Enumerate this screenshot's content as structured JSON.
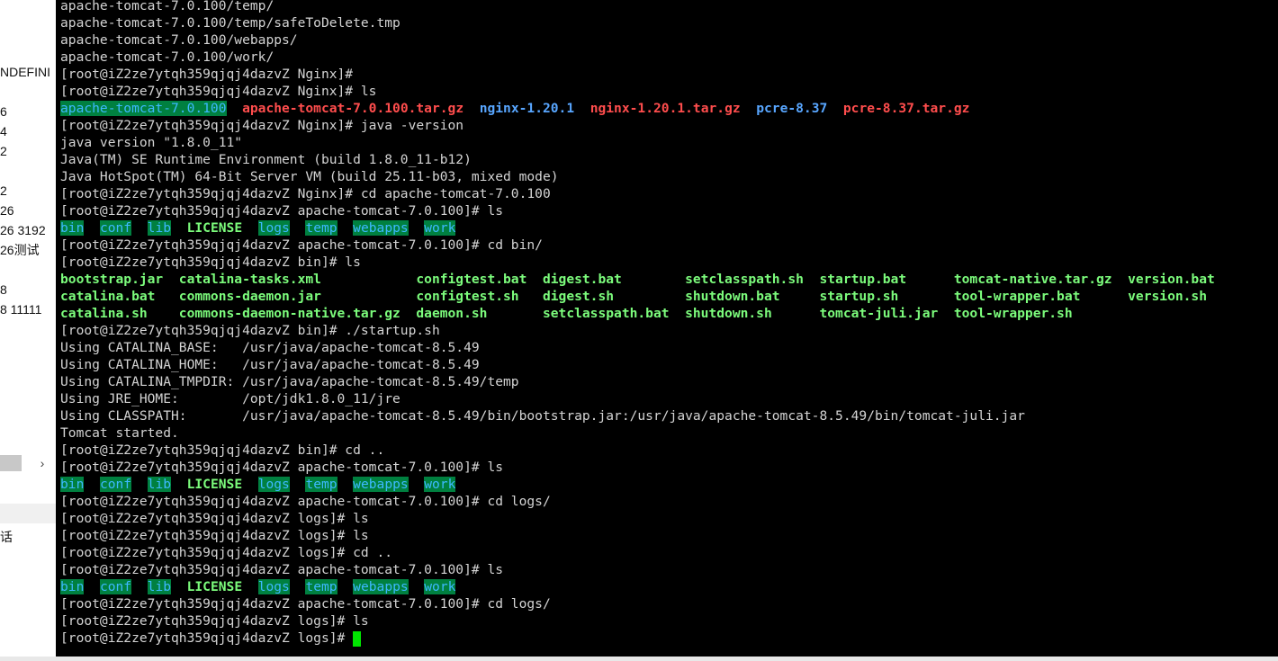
{
  "colors": {
    "background": "#000000",
    "default": "#d4d4d4",
    "dir": "#58a6ff",
    "archive": "#ff4d4d",
    "exec": "#7cfc7c",
    "dir_hl_bg": "#008040",
    "dir_hl_fg": "#3db8ff",
    "cursor": "#00e600"
  },
  "left_panel": {
    "fragments": [
      "NDEFINI",
      "6",
      "4",
      "2",
      "2",
      "26",
      "26  3192",
      "26测试",
      "8",
      "8  11111",
      "话"
    ],
    "scroll_arrow": "›"
  },
  "terminal": {
    "lines": [
      [
        {
          "t": "apache-tomcat-7.0.100/temp/",
          "c": "default"
        }
      ],
      [
        {
          "t": "apache-tomcat-7.0.100/temp/safeToDelete.tmp",
          "c": "default"
        }
      ],
      [
        {
          "t": "apache-tomcat-7.0.100/webapps/",
          "c": "default"
        }
      ],
      [
        {
          "t": "apache-tomcat-7.0.100/work/",
          "c": "default"
        }
      ],
      [
        {
          "t": "[root@iZ2ze7ytqh359qjqj4dazvZ Nginx]#",
          "c": "default"
        }
      ],
      [
        {
          "t": "[root@iZ2ze7ytqh359qjqj4dazvZ Nginx]# ls",
          "c": "default"
        }
      ],
      [
        {
          "t": "apache-tomcat-7.0.100",
          "c": "dirhl"
        },
        {
          "t": "  ",
          "c": "default"
        },
        {
          "t": "apache-tomcat-7.0.100.tar.gz",
          "c": "archive"
        },
        {
          "t": "  ",
          "c": "default"
        },
        {
          "t": "nginx-1.20.1",
          "c": "dir"
        },
        {
          "t": "  ",
          "c": "default"
        },
        {
          "t": "nginx-1.20.1.tar.gz",
          "c": "archive"
        },
        {
          "t": "  ",
          "c": "default"
        },
        {
          "t": "pcre-8.37",
          "c": "dir"
        },
        {
          "t": "  ",
          "c": "default"
        },
        {
          "t": "pcre-8.37.tar.gz",
          "c": "archive"
        }
      ],
      [
        {
          "t": "[root@iZ2ze7ytqh359qjqj4dazvZ Nginx]# java -version",
          "c": "default"
        }
      ],
      [
        {
          "t": "java version \"1.8.0_11\"",
          "c": "default"
        }
      ],
      [
        {
          "t": "Java(TM) SE Runtime Environment (build 1.8.0_11-b12)",
          "c": "default"
        }
      ],
      [
        {
          "t": "Java HotSpot(TM) 64-Bit Server VM (build 25.11-b03, mixed mode)",
          "c": "default"
        }
      ],
      [
        {
          "t": "[root@iZ2ze7ytqh359qjqj4dazvZ Nginx]# cd apache-tomcat-7.0.100",
          "c": "default"
        }
      ],
      [
        {
          "t": "[root@iZ2ze7ytqh359qjqj4dazvZ apache-tomcat-7.0.100]# ls",
          "c": "default"
        }
      ],
      [
        {
          "t": "bin",
          "c": "dirhl"
        },
        {
          "t": "  ",
          "c": "default"
        },
        {
          "t": "conf",
          "c": "dirhl"
        },
        {
          "t": "  ",
          "c": "default"
        },
        {
          "t": "lib",
          "c": "dirhl"
        },
        {
          "t": "  ",
          "c": "default"
        },
        {
          "t": "LICENSE",
          "c": "exec"
        },
        {
          "t": "  ",
          "c": "default"
        },
        {
          "t": "logs",
          "c": "dirhl"
        },
        {
          "t": "  ",
          "c": "default"
        },
        {
          "t": "temp",
          "c": "dirhl"
        },
        {
          "t": "  ",
          "c": "default"
        },
        {
          "t": "webapps",
          "c": "dirhl"
        },
        {
          "t": "  ",
          "c": "default"
        },
        {
          "t": "work",
          "c": "dirhl"
        }
      ],
      [
        {
          "t": "[root@iZ2ze7ytqh359qjqj4dazvZ apache-tomcat-7.0.100]# cd bin/",
          "c": "default"
        }
      ],
      [
        {
          "t": "[root@iZ2ze7ytqh359qjqj4dazvZ bin]# ls",
          "c": "default"
        }
      ],
      [
        {
          "t": "bootstrap.jar  catalina-tasks.xml            configtest.bat  digest.bat        setclasspath.sh  startup.bat      tomcat-native.tar.gz  version.bat",
          "c": "exec"
        }
      ],
      [
        {
          "t": "catalina.bat   commons-daemon.jar            configtest.sh   digest.sh         shutdown.bat     startup.sh       tool-wrapper.bat      version.sh",
          "c": "exec"
        }
      ],
      [
        {
          "t": "catalina.sh    commons-daemon-native.tar.gz  daemon.sh       setclasspath.bat  shutdown.sh      tomcat-juli.jar  tool-wrapper.sh",
          "c": "exec"
        }
      ],
      [
        {
          "t": "[root@iZ2ze7ytqh359qjqj4dazvZ bin]# ./startup.sh",
          "c": "default"
        }
      ],
      [
        {
          "t": "Using CATALINA_BASE:   /usr/java/apache-tomcat-8.5.49",
          "c": "default"
        }
      ],
      [
        {
          "t": "Using CATALINA_HOME:   /usr/java/apache-tomcat-8.5.49",
          "c": "default"
        }
      ],
      [
        {
          "t": "Using CATALINA_TMPDIR: /usr/java/apache-tomcat-8.5.49/temp",
          "c": "default"
        }
      ],
      [
        {
          "t": "Using JRE_HOME:        /opt/jdk1.8.0_11/jre",
          "c": "default"
        }
      ],
      [
        {
          "t": "Using CLASSPATH:       /usr/java/apache-tomcat-8.5.49/bin/bootstrap.jar:/usr/java/apache-tomcat-8.5.49/bin/tomcat-juli.jar",
          "c": "default"
        }
      ],
      [
        {
          "t": "Tomcat started.",
          "c": "default"
        }
      ],
      [
        {
          "t": "[root@iZ2ze7ytqh359qjqj4dazvZ bin]# cd ..",
          "c": "default"
        }
      ],
      [
        {
          "t": "[root@iZ2ze7ytqh359qjqj4dazvZ apache-tomcat-7.0.100]# ls",
          "c": "default"
        }
      ],
      [
        {
          "t": "bin",
          "c": "dirhl"
        },
        {
          "t": "  ",
          "c": "default"
        },
        {
          "t": "conf",
          "c": "dirhl"
        },
        {
          "t": "  ",
          "c": "default"
        },
        {
          "t": "lib",
          "c": "dirhl"
        },
        {
          "t": "  ",
          "c": "default"
        },
        {
          "t": "LICENSE",
          "c": "exec"
        },
        {
          "t": "  ",
          "c": "default"
        },
        {
          "t": "logs",
          "c": "dirhl"
        },
        {
          "t": "  ",
          "c": "default"
        },
        {
          "t": "temp",
          "c": "dirhl"
        },
        {
          "t": "  ",
          "c": "default"
        },
        {
          "t": "webapps",
          "c": "dirhl"
        },
        {
          "t": "  ",
          "c": "default"
        },
        {
          "t": "work",
          "c": "dirhl"
        }
      ],
      [
        {
          "t": "[root@iZ2ze7ytqh359qjqj4dazvZ apache-tomcat-7.0.100]# cd logs/",
          "c": "default"
        }
      ],
      [
        {
          "t": "[root@iZ2ze7ytqh359qjqj4dazvZ logs]# ls",
          "c": "default"
        }
      ],
      [
        {
          "t": "[root@iZ2ze7ytqh359qjqj4dazvZ logs]# ls",
          "c": "default"
        }
      ],
      [
        {
          "t": "[root@iZ2ze7ytqh359qjqj4dazvZ logs]# cd ..",
          "c": "default"
        }
      ],
      [
        {
          "t": "[root@iZ2ze7ytqh359qjqj4dazvZ apache-tomcat-7.0.100]# ls",
          "c": "default"
        }
      ],
      [
        {
          "t": "bin",
          "c": "dirhl"
        },
        {
          "t": "  ",
          "c": "default"
        },
        {
          "t": "conf",
          "c": "dirhl"
        },
        {
          "t": "  ",
          "c": "default"
        },
        {
          "t": "lib",
          "c": "dirhl"
        },
        {
          "t": "  ",
          "c": "default"
        },
        {
          "t": "LICENSE",
          "c": "exec"
        },
        {
          "t": "  ",
          "c": "default"
        },
        {
          "t": "logs",
          "c": "dirhl"
        },
        {
          "t": "  ",
          "c": "default"
        },
        {
          "t": "temp",
          "c": "dirhl"
        },
        {
          "t": "  ",
          "c": "default"
        },
        {
          "t": "webapps",
          "c": "dirhl"
        },
        {
          "t": "  ",
          "c": "default"
        },
        {
          "t": "work",
          "c": "dirhl"
        }
      ],
      [
        {
          "t": "[root@iZ2ze7ytqh359qjqj4dazvZ apache-tomcat-7.0.100]# cd logs/",
          "c": "default"
        }
      ],
      [
        {
          "t": "[root@iZ2ze7ytqh359qjqj4dazvZ logs]# ls",
          "c": "default"
        }
      ],
      [
        {
          "t": "[root@iZ2ze7ytqh359qjqj4dazvZ logs]# ",
          "c": "default"
        },
        {
          "t": "",
          "c": "cursor"
        }
      ]
    ]
  }
}
